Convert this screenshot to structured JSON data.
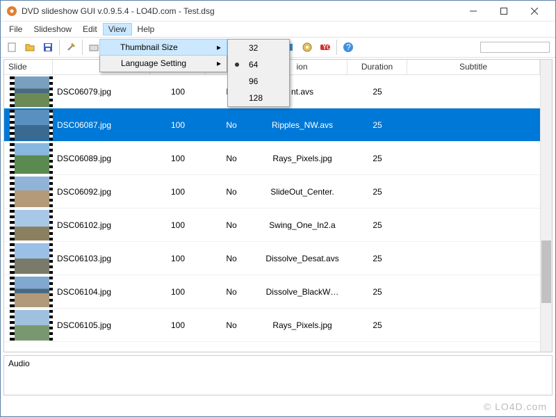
{
  "window": {
    "title": "DVD slideshow GUI v.0.9.5.4 - LO4D.com - Test.dsg"
  },
  "menu": {
    "file": "File",
    "slideshow": "Slideshow",
    "edit": "Edit",
    "view": "View",
    "help": "Help"
  },
  "view_dropdown": {
    "thumb_size": "Thumbnail Size",
    "lang": "Language Setting"
  },
  "thumb_sizes": {
    "s32": "32",
    "s64": "64",
    "s96": "96",
    "s128": "128"
  },
  "columns": {
    "slide": "Slide",
    "frames": "",
    "anim": "",
    "trans": "ion",
    "dur": "Duration",
    "sub": "Subtitle"
  },
  "rows": [
    {
      "name": "DSC06079.jpg",
      "frames": "100",
      "anim": "No",
      "trans": "nt.avs",
      "dur": "25",
      "thumb": "linear-gradient(#7aa0c0 40%, #4a6a80 40% 55%, #6b8a55 55%)"
    },
    {
      "name": "DSC06087.jpg",
      "frames": "100",
      "anim": "No",
      "trans": "Ripples_NW.avs",
      "dur": "25",
      "thumb": "linear-gradient(#5a90c0 50%, #3a6a90 50%)",
      "selected": true
    },
    {
      "name": "DSC06089.jpg",
      "frames": "100",
      "anim": "No",
      "trans": "Rays_Pixels.jpg",
      "dur": "25",
      "thumb": "linear-gradient(#88b8e0 40%, #5a8a50 40%)"
    },
    {
      "name": "DSC06092.jpg",
      "frames": "100",
      "anim": "No",
      "trans": "SlideOut_Center.",
      "dur": "25",
      "thumb": "linear-gradient(#90b4d8 45%, #b49a78 45%)"
    },
    {
      "name": "DSC06102.jpg",
      "frames": "100",
      "anim": "No",
      "trans": "Swing_One_In2.a",
      "dur": "25",
      "thumb": "linear-gradient(#a8c8e8 55%, #8a8060 55%)"
    },
    {
      "name": "DSC06103.jpg",
      "frames": "100",
      "anim": "No",
      "trans": "Dissolve_Desat.avs",
      "dur": "25",
      "thumb": "linear-gradient(#9ac0e8 50%, #7a7a6a 50%)"
    },
    {
      "name": "DSC06104.jpg",
      "frames": "100",
      "anim": "No",
      "trans": "Dissolve_BlackW…",
      "dur": "25",
      "thumb": "linear-gradient(#80a8d0 40%, #4a6a80 40% 55%, #b09a7a 55%)"
    },
    {
      "name": "DSC06105.jpg",
      "frames": "100",
      "anim": "No",
      "trans": "Rays_Pixels.jpg",
      "dur": "25",
      "thumb": "linear-gradient(#a0c0e0 50%, #7a9870 50%)"
    }
  ],
  "audio": {
    "label": "Audio"
  },
  "watermark": "© LO4D.com"
}
